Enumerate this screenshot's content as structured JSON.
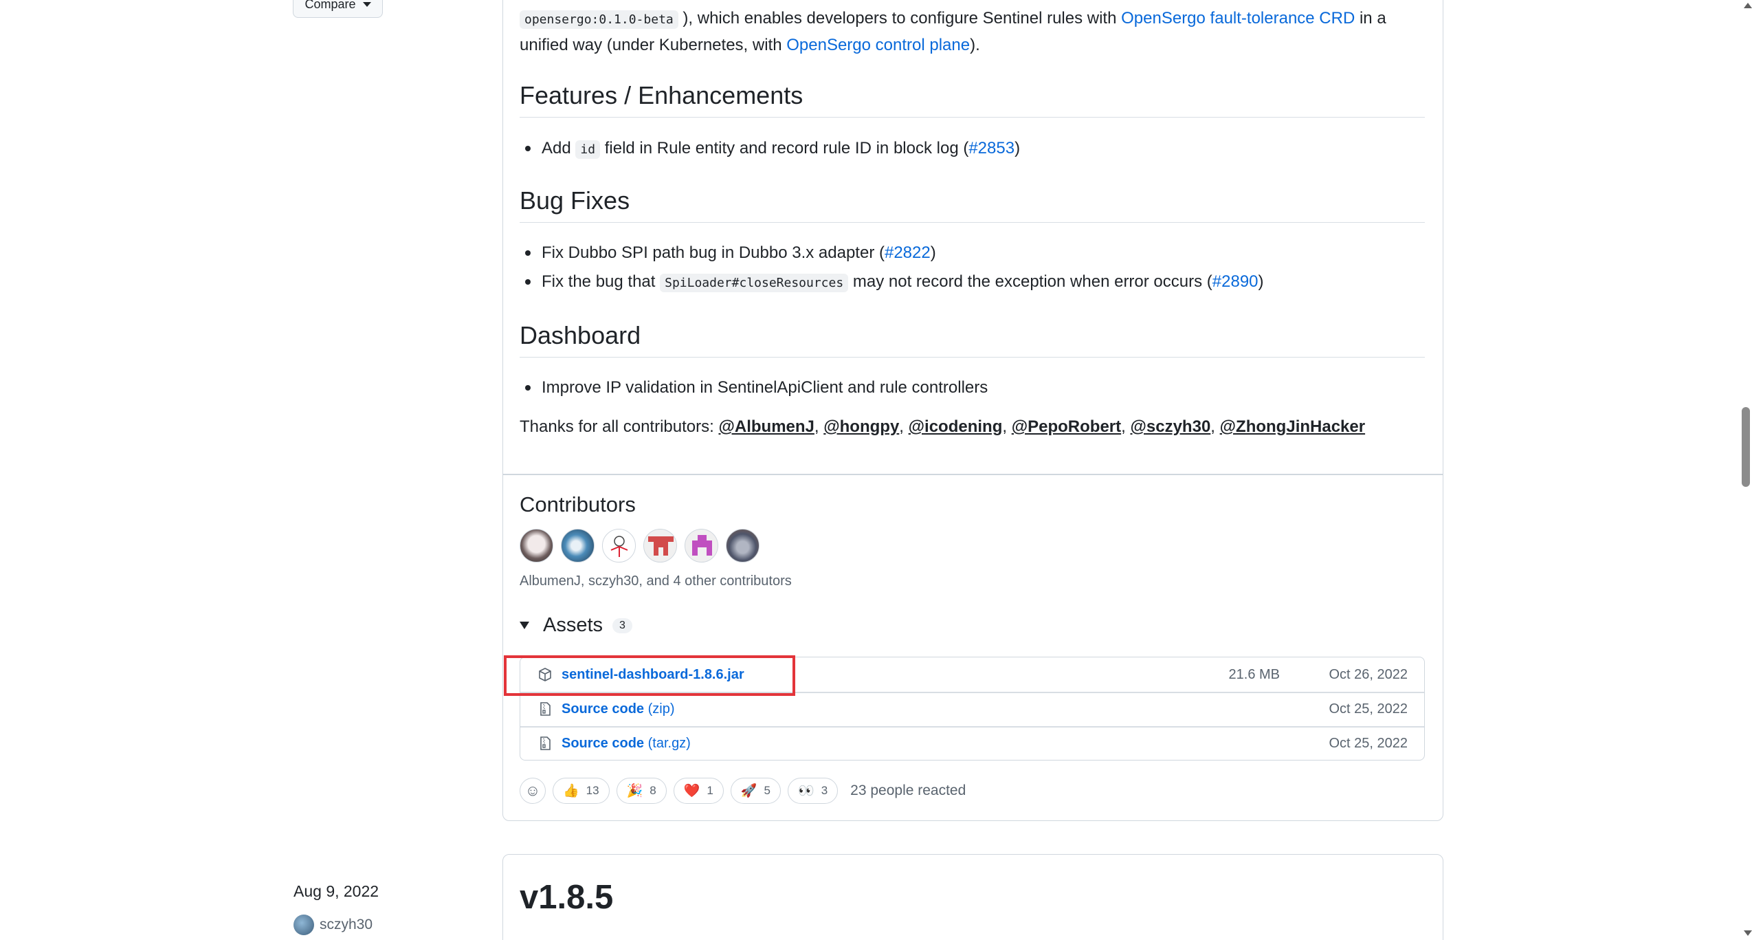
{
  "sidebar": {
    "compare_label": "Compare",
    "release_date": "Aug 9, 2022",
    "release_author": "sczyh30"
  },
  "release": {
    "intro_code": "opensergo:0.1.0-beta",
    "intro_text1": "), which enables developers to configure Sentinel rules with",
    "intro_link1": "OpenSergo fault-tolerance CRD",
    "intro_text2": "in a",
    "intro_text3": "unified way (under Kubernetes, with",
    "intro_link2": "OpenSergo control plane",
    "intro_text4": ").",
    "features_heading": "Features / Enhancements",
    "features": {
      "item1_prefix": "Add",
      "item1_code": "id",
      "item1_text": "field in Rule entity and record rule ID in block log (",
      "item1_link": "#2853",
      "item1_suffix": ")"
    },
    "bugfix_heading": "Bug Fixes",
    "bugfixes": {
      "item1_text": "Fix Dubbo SPI path bug in Dubbo 3.x adapter (",
      "item1_link": "#2822",
      "item1_suffix": ")",
      "item2_prefix": "Fix the bug that",
      "item2_code": "SpiLoader#closeResources",
      "item2_text": "may not record the exception when error occurs (",
      "item2_link": "#2890",
      "item2_suffix": ")"
    },
    "dashboard_heading": "Dashboard",
    "dashboard": {
      "item1_text": "Improve IP validation in SentinelApiClient and rule controllers"
    },
    "thanks_prefix": "Thanks for all contributors:",
    "contributors_links": [
      "@AlbumenJ",
      "@hongpy",
      "@icodening",
      "@PepoRobert",
      "@sczyh30",
      "@ZhongJinHacker"
    ]
  },
  "contributors": {
    "title": "Contributors",
    "summary": "AlbumenJ, sczyh30, and 4 other contributors"
  },
  "assets": {
    "title": "Assets",
    "count": "3",
    "items": [
      {
        "name": "sentinel-dashboard-1.8.6.jar",
        "ext": "",
        "size": "21.6 MB",
        "date": "Oct 26, 2022",
        "icon": "package-icon"
      },
      {
        "name": "Source code",
        "ext": "(zip)",
        "size": "",
        "date": "Oct 25, 2022",
        "icon": "file-zip-icon"
      },
      {
        "name": "Source code",
        "ext": "(tar.gz)",
        "size": "",
        "date": "Oct 25, 2022",
        "icon": "file-zip-icon"
      }
    ]
  },
  "reactions": {
    "items": [
      {
        "emoji": "👍",
        "count": "13"
      },
      {
        "emoji": "🎉",
        "count": "8"
      },
      {
        "emoji": "❤️",
        "count": "1"
      },
      {
        "emoji": "🚀",
        "count": "5"
      },
      {
        "emoji": "👀",
        "count": "3"
      }
    ],
    "summary": "23 people reacted"
  },
  "next_release": {
    "title": "v1.8.5"
  },
  "colors": {
    "link": "#0969da",
    "highlight_border": "#e3343a",
    "border": "#d0d7de"
  }
}
